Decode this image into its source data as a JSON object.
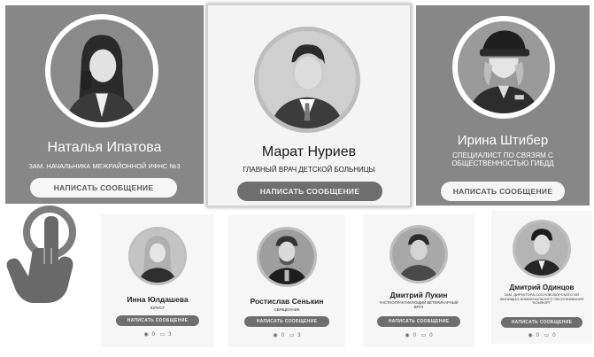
{
  "featured": [
    {
      "name": "Наталья Ипатова",
      "role": "ЗАМ. НАЧАЛЬНИКА МЕЖРАЙОННОЙ ИФНС №3",
      "button": "НАПИСАТЬ СООБЩЕНИЕ"
    },
    {
      "name": "Марат Нуриев",
      "role": "ГЛАВНЫЙ ВРАЧ ДЕТСКОЙ БОЛЬНИЦЫ",
      "button": "НАПИСАТЬ СООБЩЕНИЕ"
    },
    {
      "name": "Ирина Штибер",
      "role_line1": "СПЕЦИАЛИСТ ПО СВЯЗЯМ С",
      "role_line2": "ОБЩЕСТВЕННОСТЬЮ ГИБДД",
      "button": "НАПИСАТЬ СООБЩЕНИЕ"
    }
  ],
  "people": [
    {
      "name": "Инна Юлдашева",
      "role": "ЮРИСТ",
      "button": "НАПИСАТЬ СООБЩЕНИЕ",
      "views": "0",
      "comments": "3"
    },
    {
      "name": "Ростислав Сенькин",
      "role": "СВЯЩЕННИК",
      "button": "НАПИСАТЬ СООБЩЕНИЕ",
      "views": "0",
      "comments": "3"
    },
    {
      "name": "Дмитрий Лукин",
      "role": "ЧАСТНОПРАКТИКУЮЩИЙ ВЕТЕРИНАРНЫЙ ВРАЧ",
      "button": "НАПИСАТЬ СООБЩЕНИЕ",
      "views": "0",
      "comments": "0"
    },
    {
      "name": "Дмитрий Одинцов",
      "role": "ЗАМ. ДИРЕКТОРА СОСНОВОБОРСКОГО МП ЖИЛИЩНО-КОММУНАЛЬНОГО ОБСЛУЖИВАНИЯ \"КОМФОРТ\"",
      "button": "НАПИСАТЬ СООБЩЕНИЕ",
      "views": "0",
      "comments": "0"
    }
  ],
  "icons": {
    "views": "eye-icon",
    "comments": "comment-icon",
    "tap": "hand-tap-icon"
  }
}
